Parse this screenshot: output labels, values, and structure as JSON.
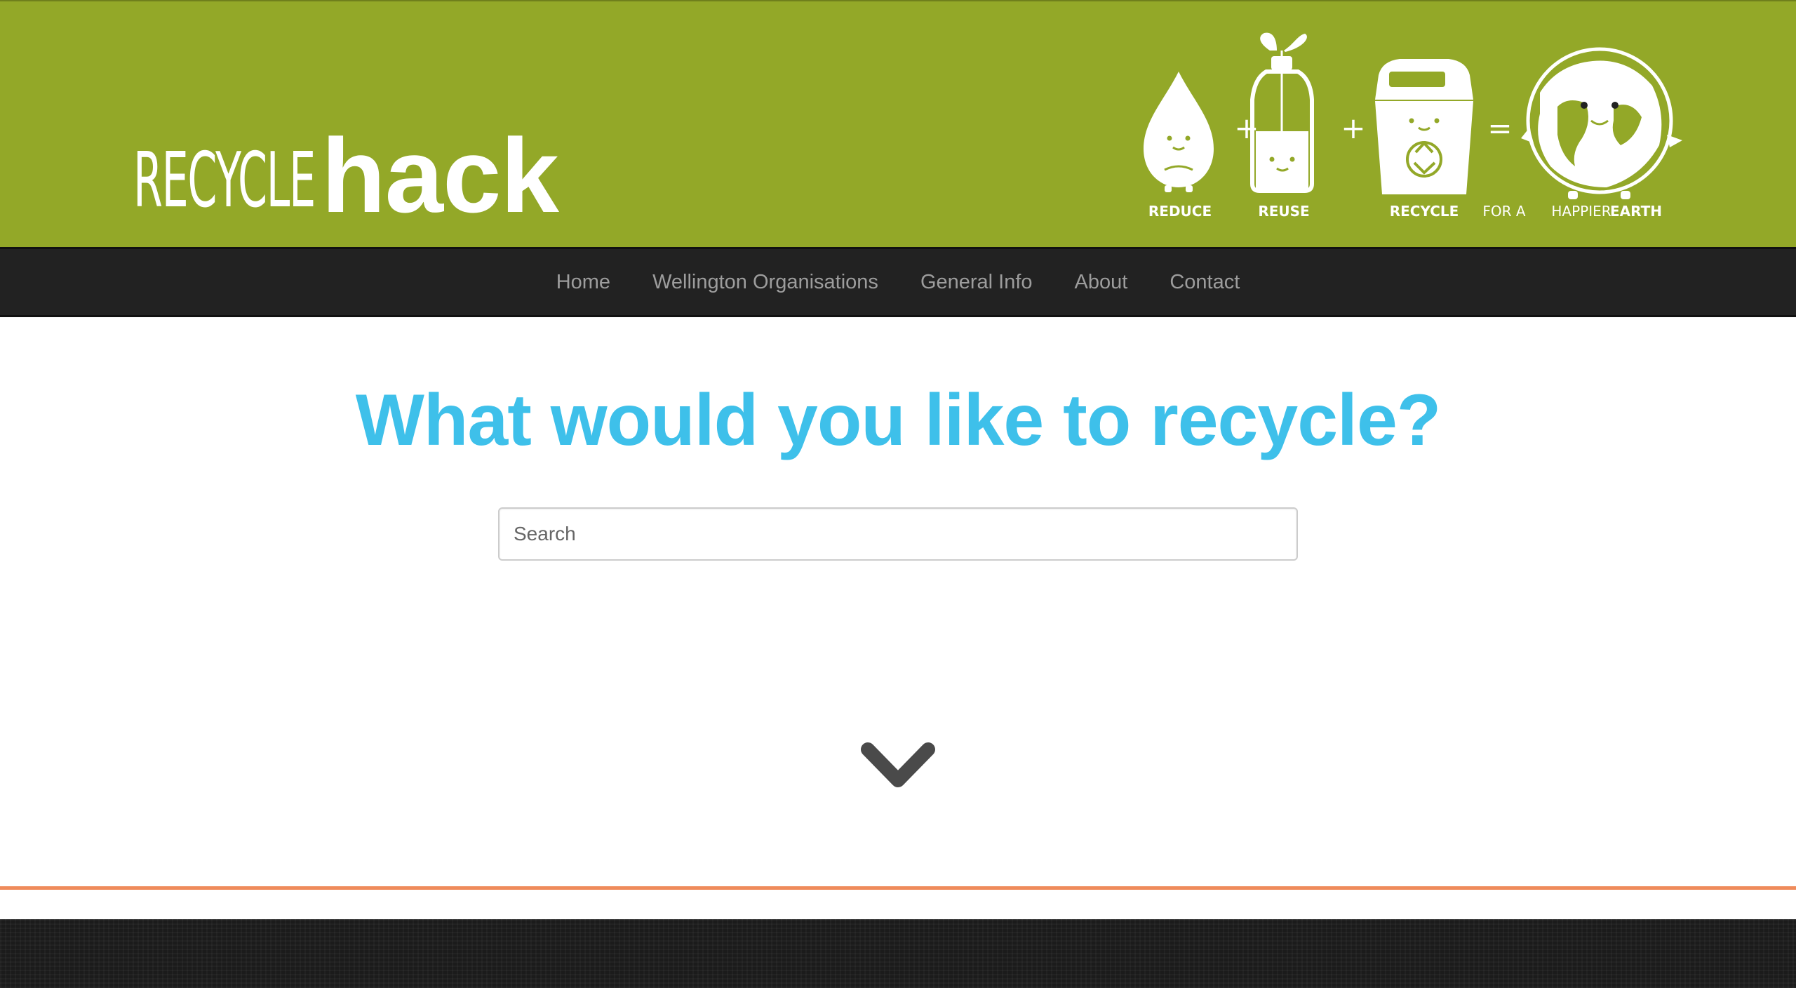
{
  "header": {
    "logo": {
      "part1": "RECYCLE",
      "part2": "hack"
    },
    "banner": {
      "reduce": "REDUCE",
      "reuse": "REUSE",
      "recycle": "RECYCLE",
      "for_a": "FOR A",
      "happier": "HAPPIER",
      "earth": "EARTH",
      "plus": "+",
      "equals": "="
    },
    "colors": {
      "background": "#93a828"
    }
  },
  "nav": {
    "items": [
      {
        "label": "Home"
      },
      {
        "label": "Wellington Organisations"
      },
      {
        "label": "General Info"
      },
      {
        "label": "About"
      },
      {
        "label": "Contact"
      }
    ]
  },
  "hero": {
    "title": "What would you like to recycle?",
    "title_color": "#3ec0ea"
  },
  "search": {
    "placeholder": "Search",
    "value": ""
  },
  "scroll": {
    "icon": "chevron-down-icon"
  },
  "colors": {
    "divider": "#ef8b5b",
    "nav_bg": "#222222",
    "footer_bg": "#1b1b1b"
  }
}
